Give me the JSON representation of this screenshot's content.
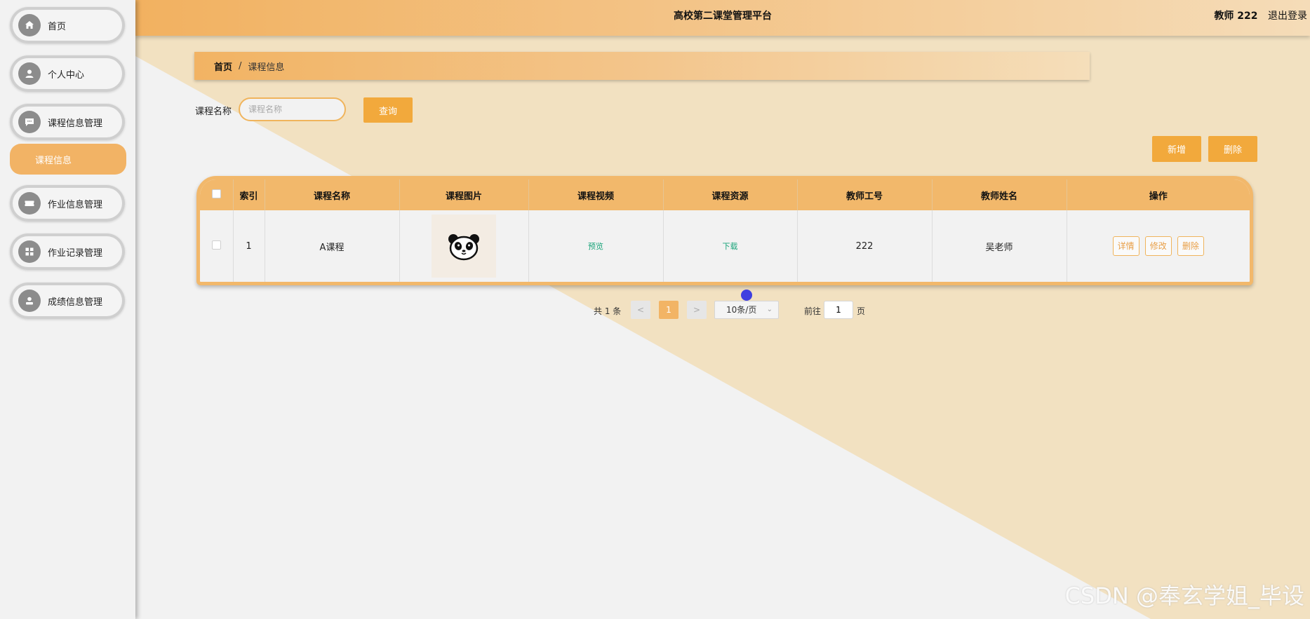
{
  "header": {
    "title": "高校第二课堂管理平台",
    "user": "教师 222",
    "logout": "退出登录"
  },
  "sidebar": {
    "items": [
      {
        "label": "首页",
        "icon": "home-icon"
      },
      {
        "label": "个人中心",
        "icon": "user-icon"
      },
      {
        "label": "课程信息管理",
        "icon": "chat-icon"
      },
      {
        "label": "作业信息管理",
        "icon": "ticket-icon"
      },
      {
        "label": "作业记录管理",
        "icon": "grid-icon"
      },
      {
        "label": "成绩信息管理",
        "icon": "person-icon"
      }
    ],
    "submenu": {
      "label": "课程信息"
    }
  },
  "breadcrumb": {
    "home": "首页",
    "sep": "/",
    "current": "课程信息"
  },
  "search": {
    "label": "课程名称",
    "placeholder": "课程名称",
    "button": "查询"
  },
  "actions": {
    "add": "新增",
    "delete": "删除"
  },
  "table": {
    "headers": [
      "索引",
      "课程名称",
      "课程图片",
      "课程视频",
      "课程资源",
      "教师工号",
      "教师姓名",
      "操作"
    ],
    "rows": [
      {
        "index": "1",
        "name": "A课程",
        "image": "panda-image",
        "video": "预览",
        "resource": "下载",
        "teacher_id": "222",
        "teacher_name": "吴老师",
        "ops": [
          "详情",
          "修改",
          "删除"
        ]
      }
    ]
  },
  "pagination": {
    "total": "共 1 条",
    "prev": "<",
    "current": "1",
    "next": ">",
    "page_size": "10条/页",
    "goto": "前往",
    "goto_value": "1",
    "unit": "页"
  },
  "watermark": "CSDN @奉玄学姐_毕设",
  "colors": {
    "accent": "#f2a93c",
    "header": "#f2b86b",
    "link": "#1aa47a"
  }
}
